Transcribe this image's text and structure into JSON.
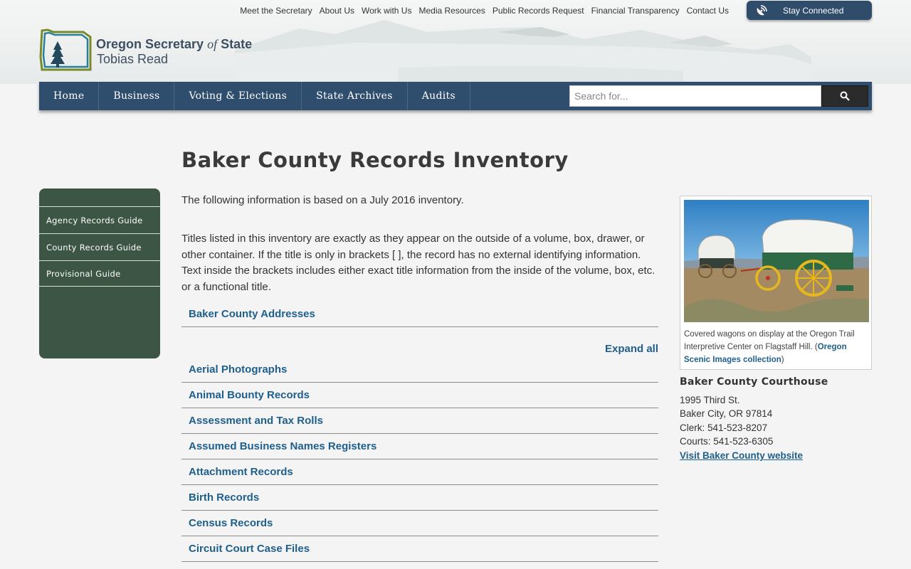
{
  "header": {
    "utility_links": [
      "Meet the Secretary",
      "About Us",
      "Work with Us",
      "Media Resources",
      "Public Records Request",
      "Financial Transparency",
      "Contact Us"
    ],
    "stay_connected": "Stay Connected",
    "logo_title_start": "Oregon Secretary ",
    "logo_title_of": "of",
    "logo_title_end": " State",
    "logo_subtitle": "Tobias Read"
  },
  "nav": {
    "items": [
      "Home",
      "Business",
      "Voting & Elections",
      "State Archives",
      "Audits"
    ],
    "search_placeholder": "Search for..."
  },
  "sidebar": {
    "items": [
      "Agency Records Guide",
      "County Records Guide",
      "Provisional Guide"
    ]
  },
  "main": {
    "title": "Baker County Records Inventory",
    "intro": "The following information is based on a July 2016 inventory.",
    "intro2": "Titles listed in this inventory are exactly as they appear on the outside of a volume, box, drawer, or other container. If the title is only in brackets [ ], the record has no external identifying information. Text inside the brackets includes either exact title information from the inside of the volume, box, etc. or a functional title.",
    "addresses_item": "Baker County Addresses",
    "expand_all": "Expand all",
    "records": [
      "Aerial Photographs",
      "Animal Bounty Records",
      "Assessment and Tax Rolls",
      "Assumed Business Names Registers",
      "Attachment Records",
      "Birth Records",
      "Census Records",
      "Circuit Court Case Files"
    ]
  },
  "aside": {
    "caption_text": "Covered wagons on display at the Oregon Trail Interpretive Center on Flagstaff Hill. (",
    "caption_link": "Oregon Scenic Images collection",
    "caption_end": ")",
    "courthouse_title": "Baker County Courthouse",
    "address_lines": [
      "1995 Third St.",
      "Baker City, OR 97814",
      "Clerk: 541-523-8207",
      "Courts: 541-523-6305"
    ],
    "website_link": "Visit Baker County website"
  },
  "colors": {
    "nav_bg": "#2f4d6d",
    "sidebar_bg": "#3d5545",
    "link": "#1f5f8b"
  }
}
